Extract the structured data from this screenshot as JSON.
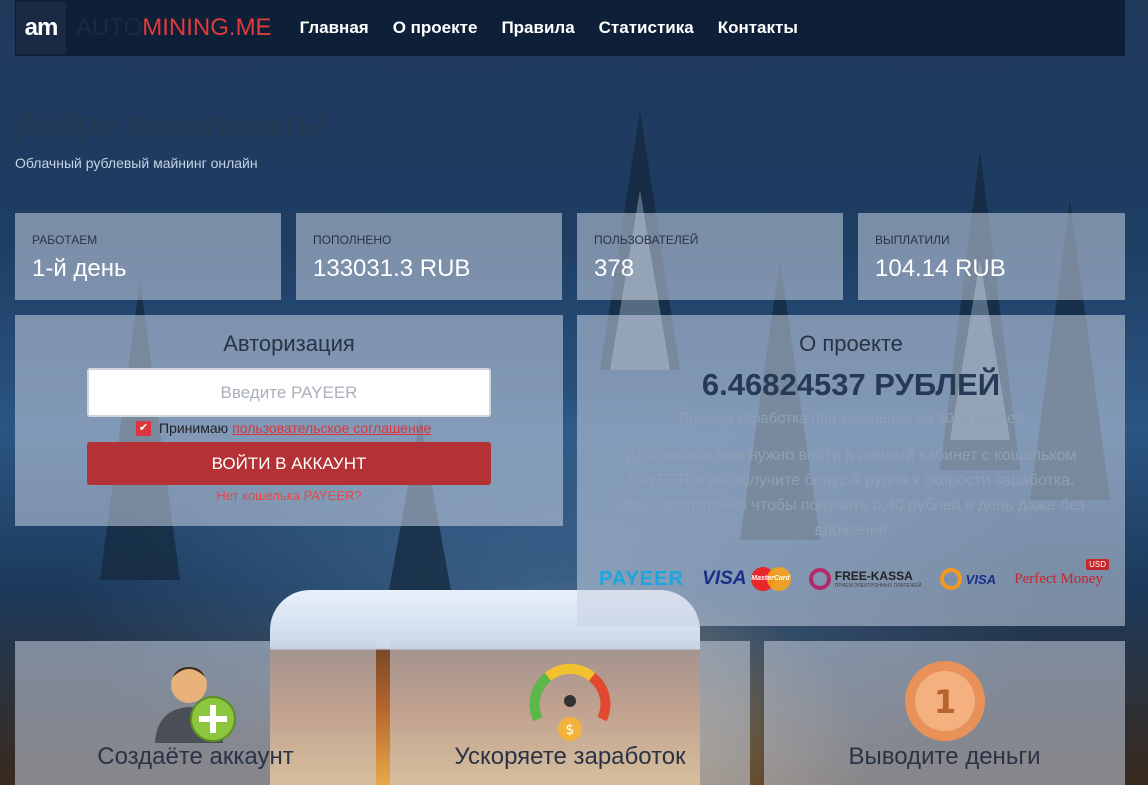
{
  "nav": {
    "logo": "am",
    "brand_part1": "AUTO",
    "brand_part2": "MINING.ME",
    "links": [
      "Главная",
      "О проекте",
      "Правила",
      "Статистика",
      "Контакты"
    ]
  },
  "hero": {
    "title": "Добро пожаловать!",
    "subtitle": "Облачный рублевый майнинг онлайн"
  },
  "stats": [
    {
      "label": "РАБОТАЕМ",
      "value": "1-й день"
    },
    {
      "label": "ПОПОЛНЕНО",
      "value": "133031.3 RUB"
    },
    {
      "label": "ПОЛЬЗОВАТЕЛЕЙ",
      "value": "378"
    },
    {
      "label": "ВЫПЛАТИЛИ",
      "value": "104.14 RUB"
    }
  ],
  "auth": {
    "title": "Авторизация",
    "placeholder": "Введите PAYEER",
    "agree_text": "Принимаю",
    "agree_link": "пользовательское соглашение",
    "login_button": "ВОЙТИ В АККАУНТ",
    "no_wallet": "Нет кошелька PAYEER?"
  },
  "about": {
    "title": "О проекте",
    "amount": "6.46824537 РУБЛЕЙ",
    "subtitle": "Пример заработка при ускорении на 3000 рублей",
    "text": "Для начала вам нужно войти в личный кабинет с кошельком PAYEER и вы получите бонус 4 рубля к скорости заработка. Этого достаточно чтобы получать 0.40 рублей в день даже без вложений",
    "payments": {
      "payeer": "PAYEER",
      "visa": "VISA",
      "mastercard": "MasterCard",
      "freekassa": "FREE-KASSA",
      "freekassa_sub": "ПРИЕМ ЭЛЕКТРОННЫХ ПЛАТЕЖЕЙ",
      "qiwi_visa": "VISA",
      "perfect_money": "Perfect Money",
      "usd": "USD"
    }
  },
  "steps": [
    {
      "title": "Создаёте аккаунт",
      "icon": "add-user-icon"
    },
    {
      "title": "Ускоряете заработок",
      "icon": "speed-gauge-icon"
    },
    {
      "title": "Выводите деньги",
      "icon": "coin-icon"
    }
  ],
  "colors": {
    "accent": "#b43236",
    "nav_bg": "#0e1f38",
    "brand_red": "#e03b3b"
  }
}
